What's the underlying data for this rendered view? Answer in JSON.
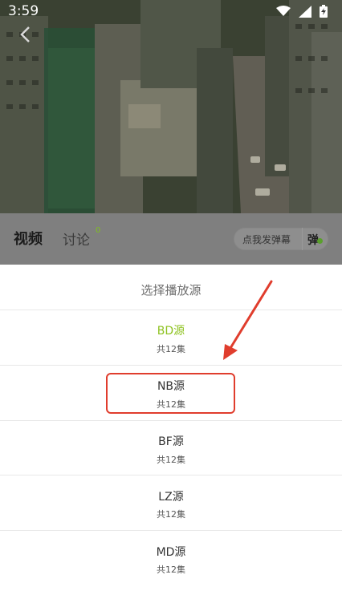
{
  "status_bar": {
    "time": "3:59",
    "wifi_icon": "wifi-icon",
    "signal_icon": "signal-icon",
    "battery_icon": "battery-charging-icon"
  },
  "header": {
    "back_icon": "back-arrow-icon",
    "tabs": [
      {
        "label": "视频"
      },
      {
        "label": "讨论",
        "badge": "0"
      }
    ],
    "danmu_placeholder": "点我发弹幕",
    "danmu_button": "弹"
  },
  "sheet": {
    "title": "选择播放源",
    "sources": [
      {
        "name": "BD源",
        "count": "共12集",
        "active": true
      },
      {
        "name": "NB源",
        "count": "共12集",
        "active": false
      },
      {
        "name": "BF源",
        "count": "共12集",
        "active": false
      },
      {
        "name": "LZ源",
        "count": "共12集",
        "active": false
      },
      {
        "name": "MD源",
        "count": "共12集",
        "active": false
      }
    ]
  },
  "colors": {
    "accent": "#8dc21f",
    "annotation": "#e03d2d"
  }
}
